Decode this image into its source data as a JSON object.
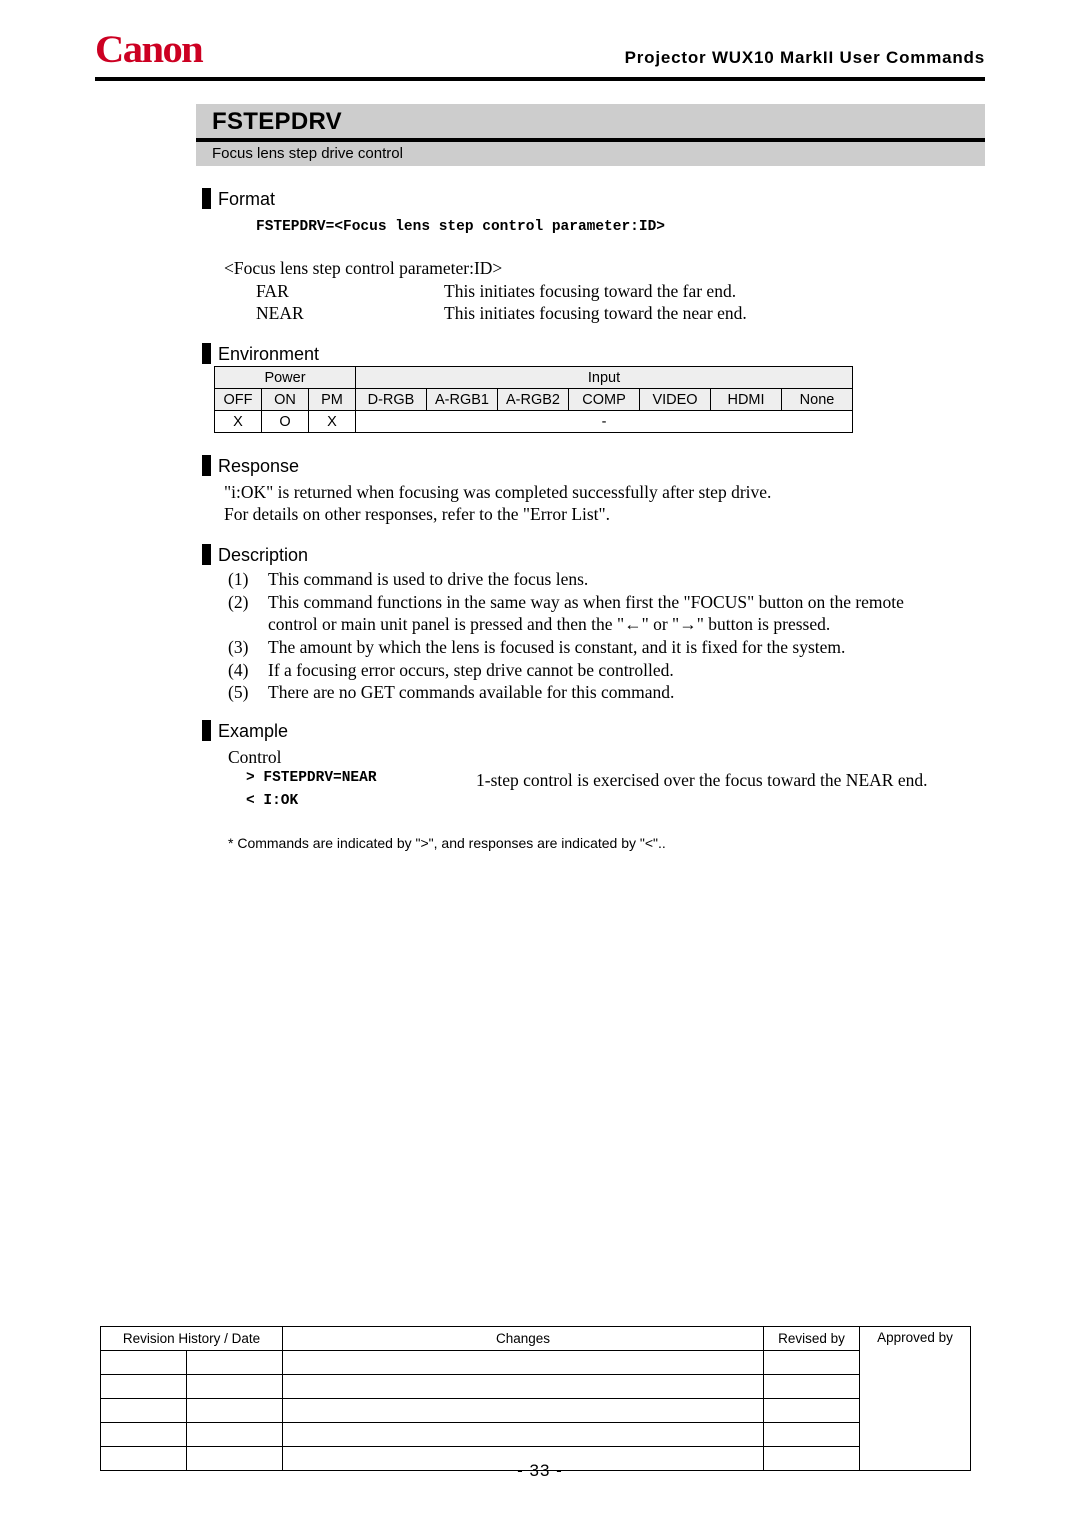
{
  "header": {
    "logo": "Canon",
    "title": "Projector  WUX10 MarkII  User  Commands",
    "brand_color": "#CC0022"
  },
  "command": {
    "name": "FSTEPDRV",
    "subtitle": "Focus lens step drive control"
  },
  "sections": {
    "format": {
      "heading": "Format",
      "syntax": "FSTEPDRV=<Focus lens step control parameter:ID>",
      "param_header": "<Focus lens step control parameter:ID>",
      "params": [
        {
          "name": "FAR",
          "description": "This initiates focusing toward the far end."
        },
        {
          "name": "NEAR",
          "description": "This initiates focusing toward the near end."
        }
      ]
    },
    "environment": {
      "heading": "Environment",
      "group_headers": {
        "power": "Power",
        "input": "Input"
      },
      "power_columns": [
        "OFF",
        "ON",
        "PM"
      ],
      "input_columns": [
        "D-RGB",
        "A-RGB1",
        "A-RGB2",
        "COMP",
        "VIDEO",
        "HDMI",
        "None"
      ],
      "power_values": [
        "X",
        "O",
        "X"
      ],
      "input_value": "-"
    },
    "response": {
      "heading": "Response",
      "lines": [
        "\"i:OK\" is returned when focusing was completed successfully after step drive.",
        "For details on other responses, refer to the \"Error List\"."
      ]
    },
    "description": {
      "heading": "Description",
      "items": [
        {
          "num": "(1)",
          "lines": [
            "This command is used to drive the focus lens."
          ]
        },
        {
          "num": "(2)",
          "lines": [
            "This command functions in the same way as when first the \"FOCUS\" button on the remote",
            "control or main unit panel is pressed and then the \"←\" or \"→\" button is pressed."
          ]
        },
        {
          "num": "(3)",
          "lines": [
            "The amount by which the lens is focused is constant, and it is fixed for the system."
          ]
        },
        {
          "num": "(4)",
          "lines": [
            "If a focusing error occurs, step drive cannot be controlled."
          ]
        },
        {
          "num": "(5)",
          "lines": [
            "There are no GET commands available for this command."
          ]
        }
      ]
    },
    "example": {
      "heading": "Example",
      "label": "Control",
      "command_line": "> FSTEPDRV=NEAR",
      "command_note": "1-step control is exercised over the focus toward the NEAR end.",
      "response_line": "< I:OK",
      "footnote": "* Commands are indicated by \">\", and responses are indicated by \"<\".."
    }
  },
  "revision_table": {
    "columns": [
      "Revision History / Date",
      "Changes",
      "Revised by",
      "Approved by"
    ],
    "rows": [
      [
        "",
        "",
        "",
        ""
      ],
      [
        "",
        "",
        "",
        ""
      ],
      [
        "",
        "",
        "",
        ""
      ],
      [
        "",
        "",
        "",
        ""
      ],
      [
        "",
        "",
        "",
        ""
      ]
    ]
  },
  "footer": {
    "page_number": "- 33 -"
  }
}
